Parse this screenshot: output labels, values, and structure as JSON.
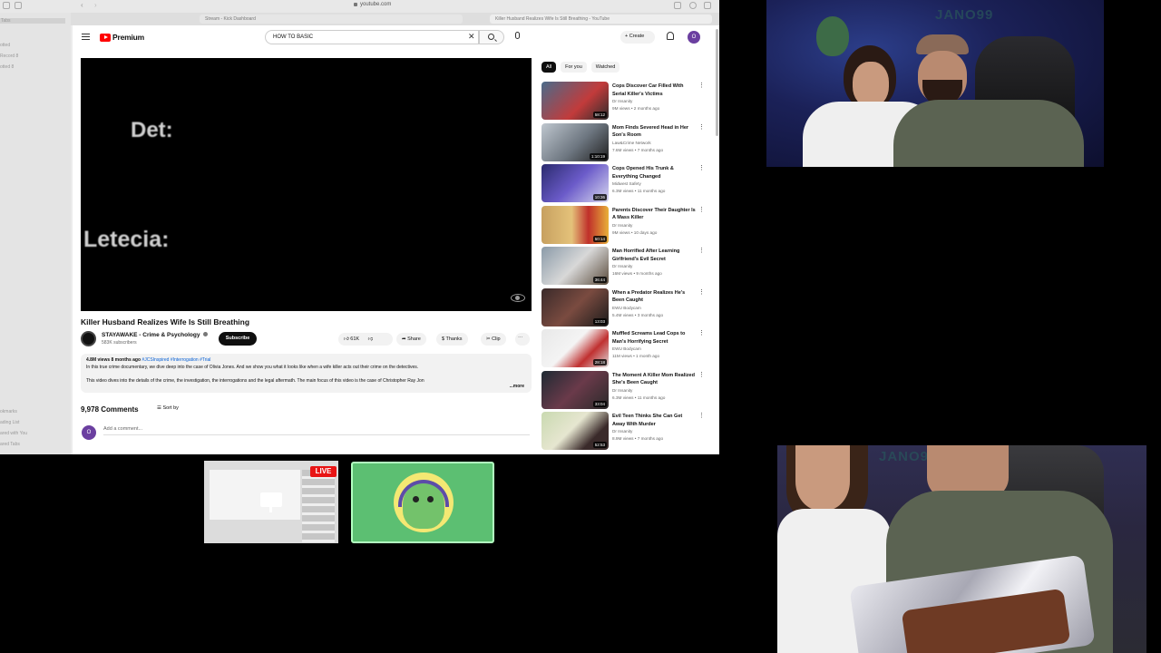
{
  "browser": {
    "url": "youtube.com",
    "tabs": [
      "Stream - Kick Dashboard",
      "Killer Husband Realizes Wife Is Still Breathing - YouTube"
    ],
    "sidebar_items": [
      "Tabs",
      "otted",
      "Record 8",
      "otted 8",
      "okmarks",
      "ading List",
      "ared with You",
      "ared Tabs"
    ]
  },
  "youtube": {
    "brand": "Premium",
    "search_value": "HOW TO BASIC",
    "create_label": "Create",
    "avatar_letter": "O",
    "player": {
      "caption_top": "Det:",
      "caption_bottom": "Letecia:"
    },
    "video": {
      "title": "Killer Husband Realizes Wife Is Still Breathing",
      "channel": "STAYAWAKE - Crime & Psychology",
      "subscribers": "583K subscribers",
      "subscribe_label": "Subscribe",
      "likes": "61K",
      "share_label": "Share",
      "thanks_label": "Thanks",
      "clip_label": "Clip",
      "more_label": "⋯",
      "views_date": "4.8M views  8 months ago",
      "tags": "#JCSInspired #Interrogation #Trial",
      "desc_line1": "In this true crime documentary, we dive deep into the case of Olivia Jones. And we show you what it looks like when a wife killer acts out their crime on the detectives.",
      "desc_line2": "This video dives into the details of the crime, the investigation, the interrogations and the legal aftermath. The main focus of this video is the case of Christopher Ray Jon",
      "desc_more": "...more"
    },
    "comments": {
      "count": "9,978 Comments",
      "sort_label": "Sort by",
      "placeholder": "Add a comment..."
    },
    "chips": [
      "All",
      "For you",
      "Watched"
    ],
    "recommendations": [
      {
        "title": "Cops Discover Car Filled With Serial Killer's Victims",
        "channel": "Dr Insanity",
        "views": "9M views • 2 months ago",
        "duration": "58:12"
      },
      {
        "title": "Mom Finds Severed Head in Her Son's Room",
        "channel": "Law&Crime Network",
        "views": "7.6M views • 7 months ago",
        "duration": "1:10:19"
      },
      {
        "title": "Cops Opened His Trunk & Everything Changed",
        "channel": "Midwest Safety",
        "views": "6.3M views • 11 months ago",
        "duration": "10:36"
      },
      {
        "title": "Parents Discover Their Daughter Is A Mass Killer",
        "channel": "Dr Insanity",
        "views": "9M views • 10 days ago",
        "duration": "50:14"
      },
      {
        "title": "Man Horrified After Learning Girlfriend's Evil Secret",
        "channel": "Dr Insanity",
        "views": "16M views • 9 months ago",
        "duration": "36:44"
      },
      {
        "title": "When a Predator Realizes He's Been Caught",
        "channel": "EWU Bodycam",
        "views": "5.4M views • 3 months ago",
        "duration": "13:03"
      },
      {
        "title": "Muffled Screams Lead Cops to Man's Horrifying Secret",
        "channel": "EWU Bodycam",
        "views": "11M views • 1 month ago",
        "duration": "28:18"
      },
      {
        "title": "The Moment A Killer Mom Realized She's Been Caught",
        "channel": "Dr Insanity",
        "views": "6.3M views • 11 months ago",
        "duration": "33:04"
      },
      {
        "title": "Evil Teen Thinks She Can Get Away With Murder",
        "channel": "Dr Insanity",
        "views": "8.9M views • 7 months ago",
        "duration": "52:53"
      }
    ]
  },
  "overlay": {
    "live_label": "LIVE",
    "cam_text_top": "JANO99",
    "cam_text_bottom": "JANO9"
  },
  "colors": {
    "yt_red": "#ff0000",
    "live_red": "#e81414",
    "avatar_tile_green": "#5cbf72",
    "avatar_purple": "#6b3fa0"
  }
}
